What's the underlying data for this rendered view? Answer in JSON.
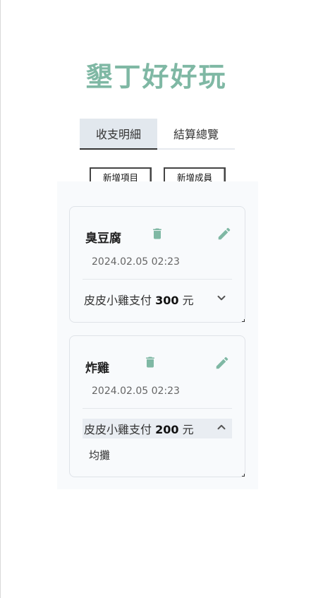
{
  "app": {
    "title": "墾丁好好玩"
  },
  "tabs": [
    {
      "label": "收支明細",
      "active": true
    },
    {
      "label": "結算總覽",
      "active": false
    }
  ],
  "actions": {
    "add_item": "新增項目",
    "add_member": "新增成員"
  },
  "colors": {
    "accent": "#7fb8a4",
    "icon": "#7fb8a4",
    "tab_active_bg": "#e2e8ee"
  },
  "items": [
    {
      "name": "臭豆腐",
      "date": "2024.02.05 02:23",
      "payer": "皮皮小雞",
      "pay_word": "支付",
      "amount": "300",
      "unit": "元",
      "expanded": false,
      "icons": {
        "delete": "trash-icon",
        "edit": "pencil-icon",
        "toggle": "chevron-down-icon"
      }
    },
    {
      "name": "炸雞",
      "date": "2024.02.05 02:23",
      "payer": "皮皮小雞",
      "pay_word": "支付",
      "amount": "200",
      "unit": "元",
      "expanded": true,
      "split": "均攤",
      "icons": {
        "delete": "trash-icon",
        "edit": "pencil-icon",
        "toggle": "chevron-up-icon"
      }
    }
  ]
}
